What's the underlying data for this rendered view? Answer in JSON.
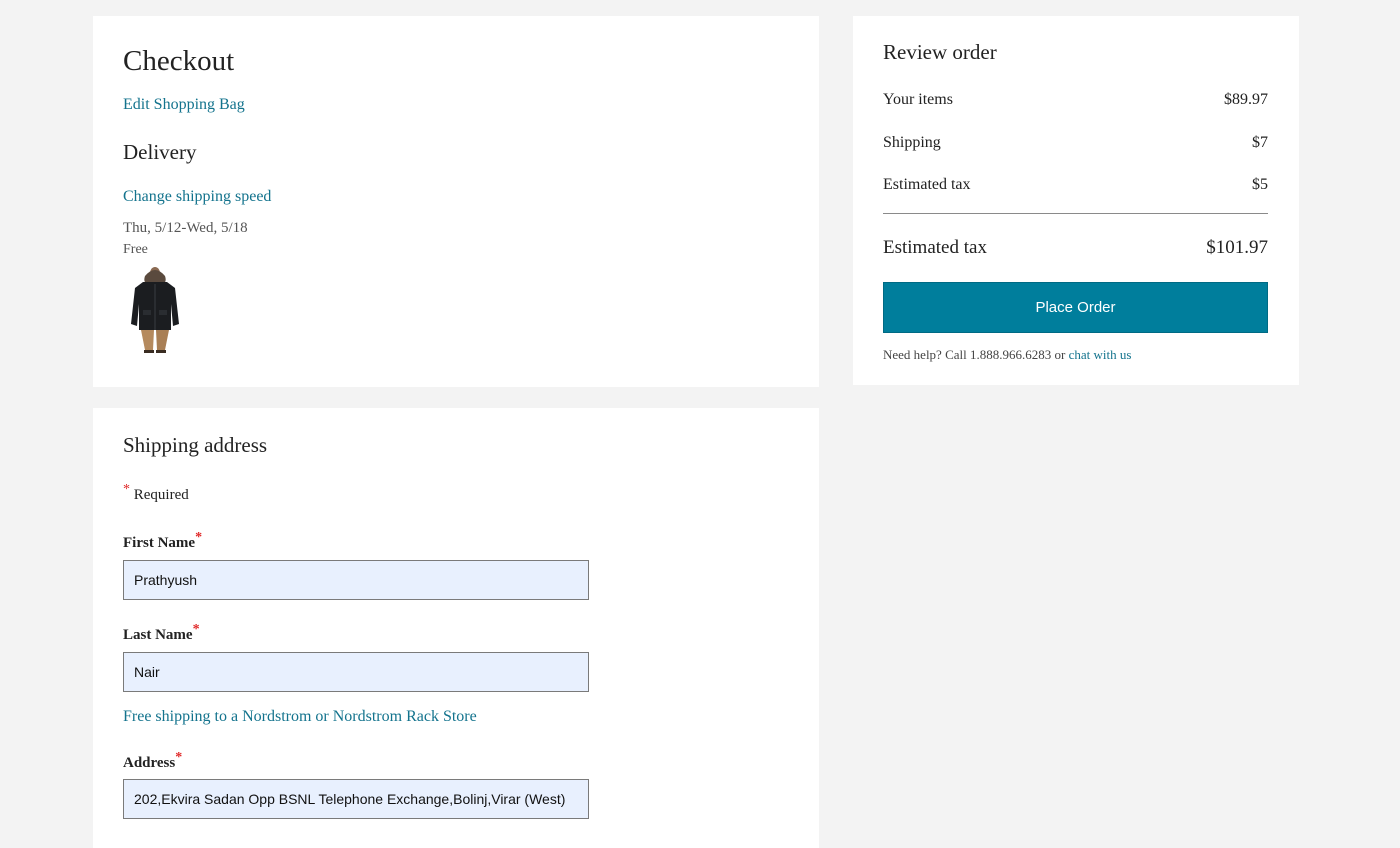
{
  "checkout": {
    "title": "Checkout",
    "edit_bag_link": "Edit Shopping Bag",
    "delivery_heading": "Delivery",
    "change_speed_link": "Change shipping speed",
    "delivery_dates": "Thu, 5/12-Wed, 5/18",
    "delivery_cost": "Free",
    "product_image": "black-parka-jacket"
  },
  "review": {
    "title": "Review order",
    "rows": [
      {
        "label": "Your items",
        "value": "$89.97"
      },
      {
        "label": "Shipping",
        "value": "$7"
      },
      {
        "label": "Estimated tax",
        "value": "$5"
      }
    ],
    "total_label": "Estimated tax",
    "total_value": "$101.97",
    "place_order_label": "Place Order",
    "help_text": "Need help? Call 1.888.966.6283 or",
    "chat_link": "chat with us"
  },
  "shipping": {
    "title": "Shipping address",
    "required_marker": "*",
    "required_note": "Required",
    "first_name_label": "First Name",
    "first_name_value": "Prathyush",
    "last_name_label": "Last Name",
    "last_name_value": "Nair",
    "store_link": "Free shipping to a Nordstrom or Nordstrom Rack Store",
    "address_label": "Address",
    "address_value": "202,Ekvira Sadan Opp BSNL Telephone Exchange,Bolinj,Virar (West)"
  },
  "colors": {
    "accent": "#007e9c",
    "link": "#13738d",
    "required": "#e02828",
    "autofill": "#e8f0fe"
  }
}
